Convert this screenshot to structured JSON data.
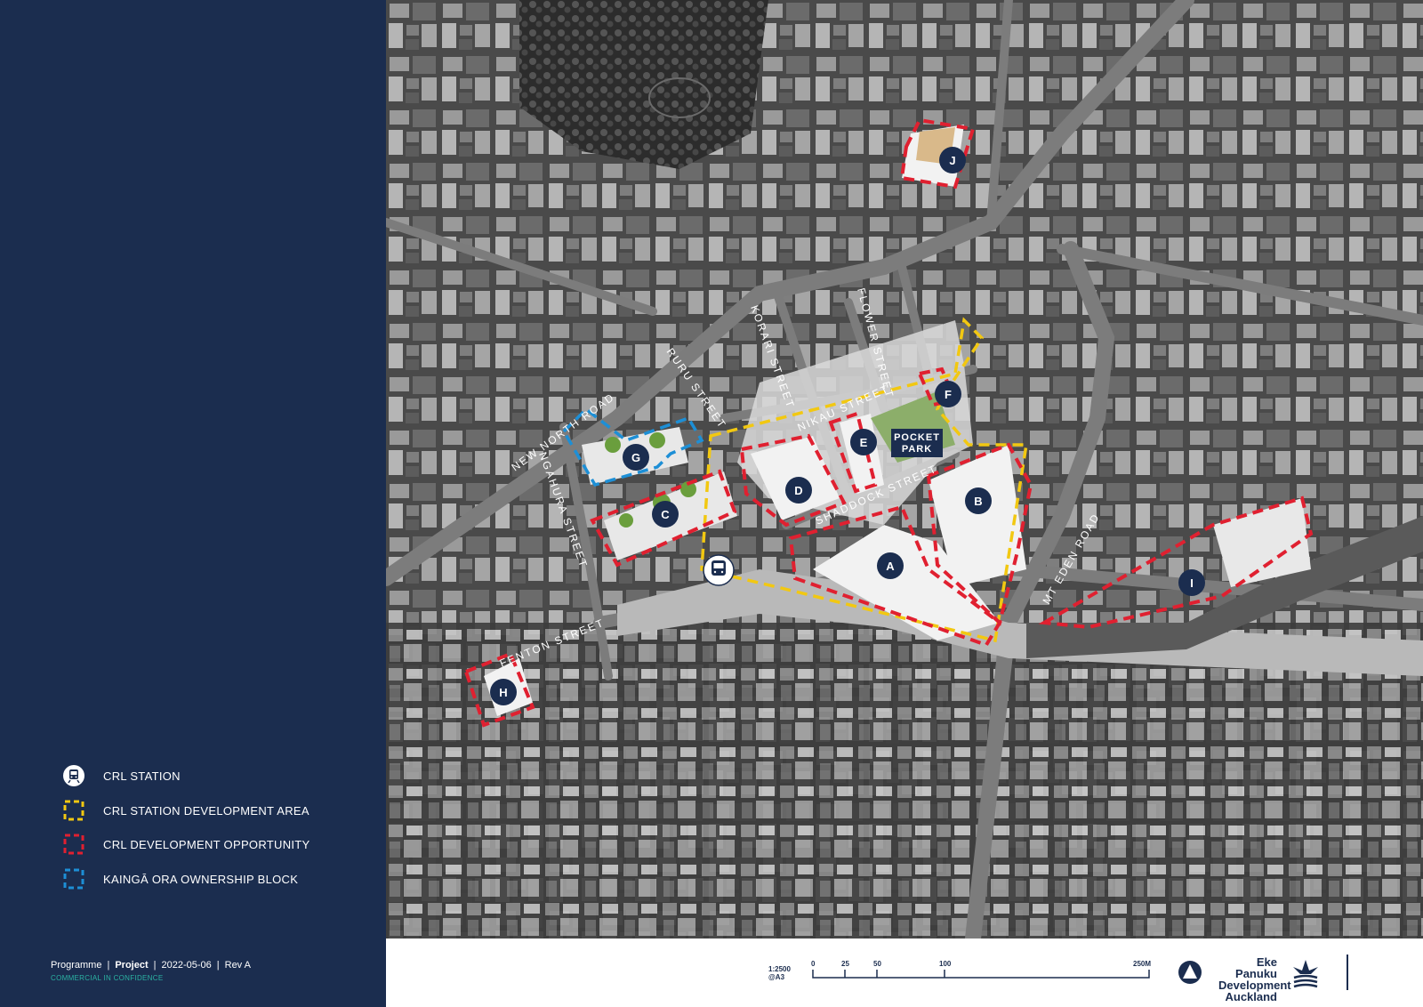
{
  "legend": [
    {
      "icon": "train-station-icon",
      "label": "CRL STATION"
    },
    {
      "icon": "yellow-dashed-frame-icon",
      "label": "CRL STATION DEVELOPMENT AREA",
      "color": "#f2c811"
    },
    {
      "icon": "red-dashed-frame-icon",
      "label": "CRL DEVELOPMENT OPPORTUNITY",
      "color": "#e02030"
    },
    {
      "icon": "blue-dashed-frame-icon",
      "label": "KAINGĀ ORA OWNERSHIP BLOCK",
      "color": "#1d8fd6"
    }
  ],
  "footer": {
    "programme": "Programme",
    "project": "Project",
    "date": "2022-05-06",
    "revision": "Rev A",
    "confidential": "COMMERCIAL IN CONFIDENCE"
  },
  "streets": {
    "new_north": "NEW NORTH ROAD",
    "ngahura": "NGAHURA STREET",
    "ruru": "RURU STREET",
    "korari": "KORARI STREET",
    "flower": "FLOWER STREET",
    "nikau": "NIKAU STREET",
    "shaddock": "SHADDOCK STREET",
    "fenton": "FENTON STREET",
    "mt_eden": "MT EDEN ROAD"
  },
  "markers": [
    "A",
    "B",
    "C",
    "D",
    "E",
    "F",
    "G",
    "H",
    "I",
    "J"
  ],
  "pocket_park": [
    "POCKET",
    "PARK"
  ],
  "scale": {
    "ratio": "1:2500",
    "paper": "@A3",
    "ticks": [
      "0",
      "25",
      "50",
      "100",
      "250M"
    ]
  },
  "brand": {
    "line1": "Eke Panuku",
    "line2": "Development",
    "line3": "Auckland"
  },
  "colors": {
    "sidebar": "#1b2d4f",
    "station_area": "#f2c811",
    "opportunity": "#e02030",
    "kainga_ora": "#1d8fd6",
    "marker": "#1b2d4f"
  }
}
